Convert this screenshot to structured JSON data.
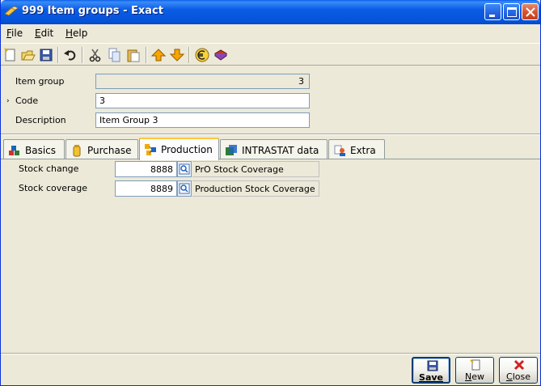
{
  "window": {
    "title": "999 Item groups - Exact",
    "controls": [
      "minimize",
      "maximize",
      "close"
    ]
  },
  "menu": {
    "items": [
      {
        "label": "File",
        "accel": "F",
        "rest": "ile"
      },
      {
        "label": "Edit",
        "accel": "E",
        "rest": "dit"
      },
      {
        "label": "Help",
        "accel": "H",
        "rest": "elp"
      }
    ]
  },
  "toolbar": {
    "icons": [
      "new-icon",
      "open-icon",
      "save-icon",
      "undo-icon",
      "cut-icon",
      "copy-icon",
      "paste-icon",
      "previous-record-icon",
      "next-record-icon",
      "euro-icon",
      "book-icon"
    ]
  },
  "header": {
    "item_group": {
      "label": "Item group",
      "value": "3"
    },
    "code": {
      "label": "Code",
      "value": "3",
      "marker": "›"
    },
    "description": {
      "label": "Description",
      "value": "Item Group 3"
    }
  },
  "tabs": [
    {
      "label": "Basics",
      "icon": "blocks-icon"
    },
    {
      "label": "Purchase",
      "icon": "jar-icon"
    },
    {
      "label": "Production",
      "icon": "production-icon",
      "active": true
    },
    {
      "label": "INTRASTAT data",
      "icon": "intrastat-icon"
    },
    {
      "label": "Extra",
      "icon": "extra-icon"
    }
  ],
  "production": {
    "stock_change": {
      "label": "Stock change",
      "account": "8888",
      "description": "PrO Stock Coverage"
    },
    "stock_coverage": {
      "label": "Stock coverage",
      "account": "8889",
      "description": "Production Stock Coverage"
    }
  },
  "buttons": {
    "save": {
      "label": "Save",
      "accel": "S",
      "rest": "ave"
    },
    "new": {
      "label": "New",
      "accel": "N",
      "rest": "ew"
    },
    "close": {
      "label": "Close",
      "accel": "C",
      "rest": "lose"
    }
  },
  "colors": {
    "titlebar": "#0553d9",
    "window_bg": "#ece9d8",
    "field_border": "#7f9db9",
    "active_tab_accent": "#ffc83c"
  }
}
